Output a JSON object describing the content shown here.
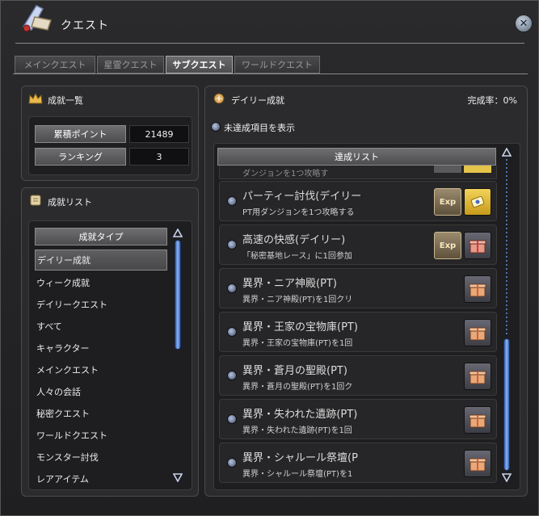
{
  "window": {
    "title": "クエスト"
  },
  "tabs": [
    {
      "label": "メインクエスト",
      "active": false
    },
    {
      "label": "星霊クエスト",
      "active": false
    },
    {
      "label": "サブクエスト",
      "active": true
    },
    {
      "label": "ワールドクエスト",
      "active": false
    }
  ],
  "summary": {
    "title": "成就一覧",
    "points_label": "累積ポイント",
    "points_value": "21489",
    "ranking_label": "ランキング",
    "ranking_value": "3"
  },
  "category_list": {
    "title": "成就リスト",
    "header": "成就タイプ",
    "items": [
      "デイリー成就",
      "ウィーク成就",
      "デイリークエスト",
      "すべて",
      "キャラクター",
      "メインクエスト",
      "人々の会話",
      "秘密クエスト",
      "ワールドクエスト",
      "モンスター討伐",
      "レアアイテム"
    ],
    "selected_index": 0
  },
  "daily": {
    "title": "デイリー成就",
    "completion_label": "完成率：0%",
    "filter_label": "未達成項目を表示",
    "list_header": "達成リスト",
    "partial_row_text": "ダンジョンを1つ攻略す",
    "achievements": [
      {
        "title": "パーティー討伐(デイリー",
        "desc": "PT用ダンジョンを1つ攻略する",
        "rewards": [
          "exp-icon",
          "coupon-icon"
        ]
      },
      {
        "title": "高速の快感(デイリー)",
        "desc": "「秘密基地レース」に1回参加",
        "rewards": [
          "exp-icon",
          "gift-box-icon"
        ]
      },
      {
        "title": "異界・ニア神殿(PT)",
        "desc": "異界・ニア神殿(PT)を1回クリ",
        "rewards": [
          "gift-box-icon"
        ]
      },
      {
        "title": "異界・王家の宝物庫(PT)",
        "desc": "異界・王家の宝物庫(PT)を1回",
        "rewards": [
          "gift-box-icon"
        ]
      },
      {
        "title": "異界・蒼月の聖殿(PT)",
        "desc": "異界・蒼月の聖殿(PT)を1回ク",
        "rewards": [
          "gift-box-icon"
        ]
      },
      {
        "title": "異界・失われた遺跡(PT)",
        "desc": "異界・失われた遺跡(PT)を1回",
        "rewards": [
          "gift-box-icon"
        ]
      },
      {
        "title": "異界・シャルール祭壇(P",
        "desc": "異界・シャルール祭壇(PT)を1",
        "rewards": [
          "gift-box-icon"
        ]
      }
    ],
    "reward_text": {
      "exp": "Exp"
    }
  },
  "colors": {
    "accent_blue": "#5f8fe0",
    "panel_bg": "#2b2b2d",
    "reward_gold": "#f2d35a"
  }
}
